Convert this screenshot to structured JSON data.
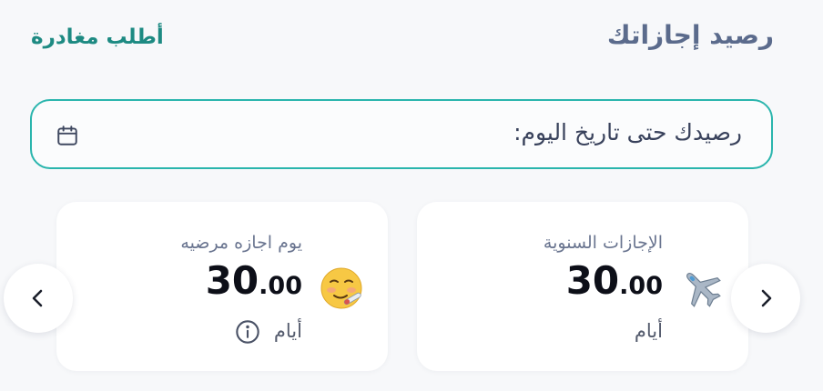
{
  "header": {
    "title": "رصيد إجازاتك",
    "request_leave_link": "أطلب مغادرة"
  },
  "balance_date_field": {
    "label": "رصيدك حتى تاريخ اليوم:",
    "icon": "calendar-icon"
  },
  "cards": [
    {
      "name": "annual",
      "title": "الإجازات السنوية",
      "value_int": "30",
      "value_dec": ".00",
      "unit": "أيام",
      "icon": "airplane-icon"
    },
    {
      "name": "sick",
      "title": "يوم اجازه مرضيه",
      "value_int": "30",
      "value_dec": ".00",
      "unit": "أيام",
      "icon": "sick-face-icon",
      "info_icon": "info-icon"
    }
  ],
  "navigation": {
    "prev_icon": "chevron-left-icon",
    "next_icon": "chevron-right-icon"
  },
  "colors": {
    "title": "#5b6b8c",
    "accent": "#1d8a82",
    "field_border": "#2ab5ad",
    "value": "#0d0f18"
  }
}
